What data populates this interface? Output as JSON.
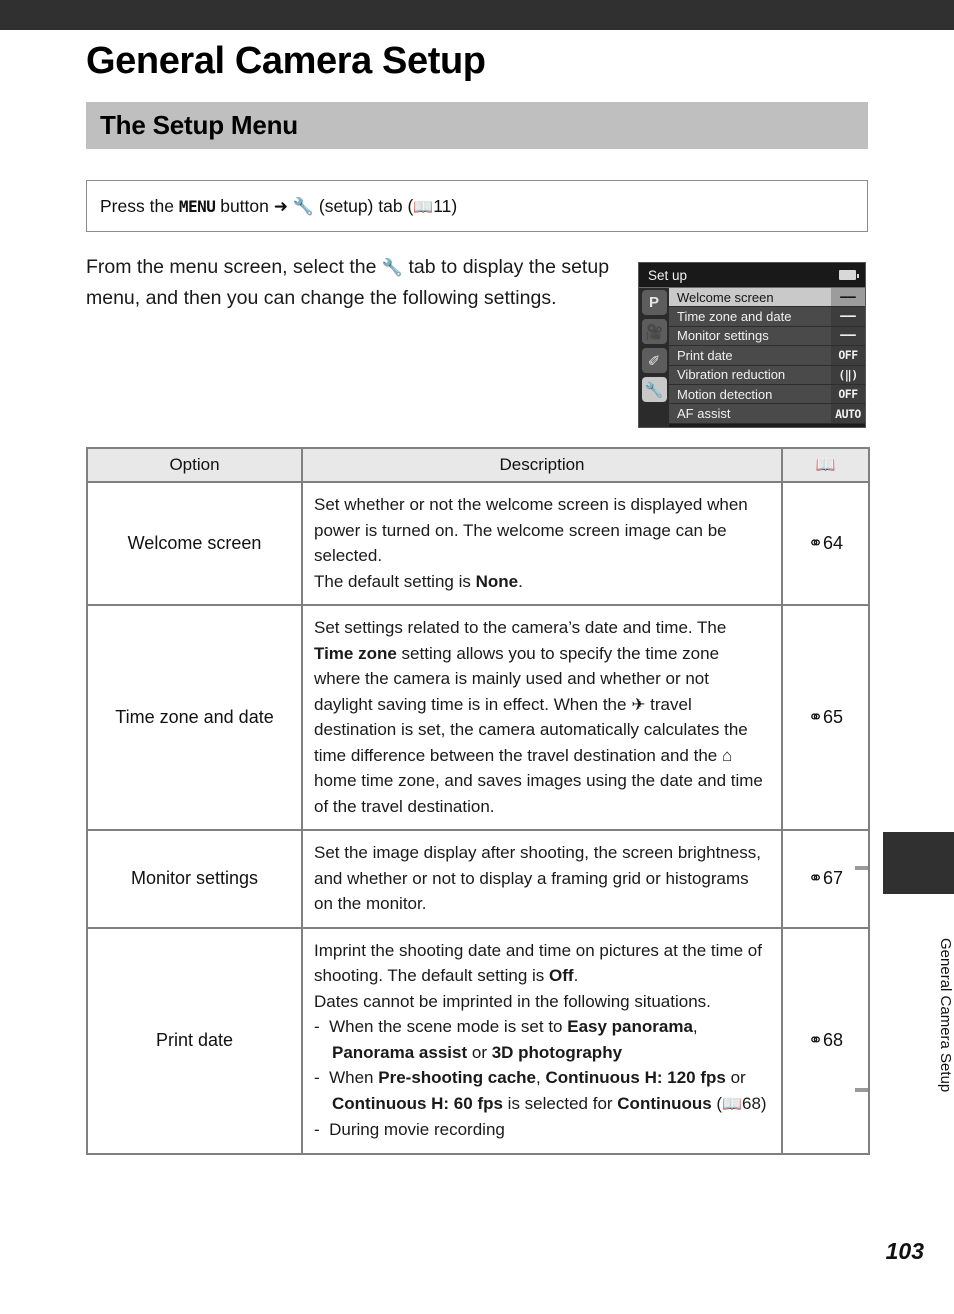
{
  "page": {
    "title": "General Camera Setup",
    "section_heading": "The Setup Menu",
    "page_number": "103",
    "side_tab_label": "General Camera Setup"
  },
  "menu_box": {
    "text_before": "Press the",
    "menu_button": "MENU",
    "text_middle": "button",
    "arrow": "➜",
    "wrench_icon": "Ÿ",
    "text_setup": "(setup) tab (",
    "book_icon": "book-icon",
    "page_ref": "11",
    "text_close": ")",
    "full_text": "Press the MENU button ➜ Ÿ (setup) tab (⌷ 11)"
  },
  "intro": {
    "part1": "From the menu screen, select the",
    "wrench_icon": "Ÿ",
    "part2": "tab to display the setup menu, and then you can change the following settings."
  },
  "lcd": {
    "title": "Set up",
    "battery_icon": "battery-icon",
    "tabs": [
      {
        "name": "shooting-mode-tab",
        "glyph": "P",
        "active": false
      },
      {
        "name": "movie-tab",
        "glyph": "✇",
        "active": false
      },
      {
        "name": "effects-tab",
        "glyph": "✐",
        "active": false
      },
      {
        "name": "setup-tab",
        "glyph": "Ÿ",
        "active": true
      }
    ],
    "rows": [
      {
        "label": "Welcome screen",
        "value": "––",
        "selected": true,
        "dash": true
      },
      {
        "label": "Time zone and date",
        "value": "––",
        "selected": false,
        "dash": true
      },
      {
        "label": "Monitor settings",
        "value": "––",
        "selected": false,
        "dash": true
      },
      {
        "label": "Print date",
        "value": "OFF",
        "selected": false,
        "dash": false
      },
      {
        "label": "Vibration reduction",
        "value": "(‖)",
        "selected": false,
        "dash": false
      },
      {
        "label": "Motion detection",
        "value": "OFF",
        "selected": false,
        "dash": false
      },
      {
        "label": "AF assist",
        "value": "AUTO",
        "selected": false,
        "dash": false
      }
    ]
  },
  "table": {
    "headers": {
      "option": "Option",
      "description": "Description",
      "reference": "book-icon"
    },
    "rows": [
      {
        "option": "Welcome screen",
        "ref_mark": "⚭",
        "ref_page": "64"
      },
      {
        "option": "Time zone and date",
        "ref_mark": "⚭",
        "ref_page": "65"
      },
      {
        "option": "Monitor settings",
        "ref_mark": "⚭",
        "ref_page": "67"
      },
      {
        "option": "Print date",
        "ref_mark": "⚭",
        "ref_page": "68"
      }
    ],
    "descriptions": {
      "welcome_screen": "Set whether or not the welcome screen is displayed when power is turned on. The welcome screen image can be selected. The default setting is None.",
      "time_zone": "Set settings related to the camera's date and time. The Time zone setting allows you to specify the time zone where the camera is mainly used and whether or not daylight saving time is in effect. When the ✈ travel destination is set, the camera automatically calculates the time difference between the travel destination and the ⌂ home time zone, and saves images using the date and time of the travel destination.",
      "monitor_settings": "Set the image display after shooting, the screen brightness, and whether or not to display a framing grid or histograms on the monitor.",
      "print_date_p1": "Imprint the shooting date and time on pictures at the time of shooting. The default setting is Off.",
      "print_date_p2": "Dates cannot be imprinted in the following situations.",
      "print_date_b1": "When the scene mode is set to Easy panorama, Panorama assist or 3D photography",
      "print_date_b2": "When Pre-shooting cache, Continuous H: 120 fps or Continuous H: 60 fps is selected for Continuous (⌷ 68)",
      "print_date_b3": "During movie recording"
    }
  }
}
